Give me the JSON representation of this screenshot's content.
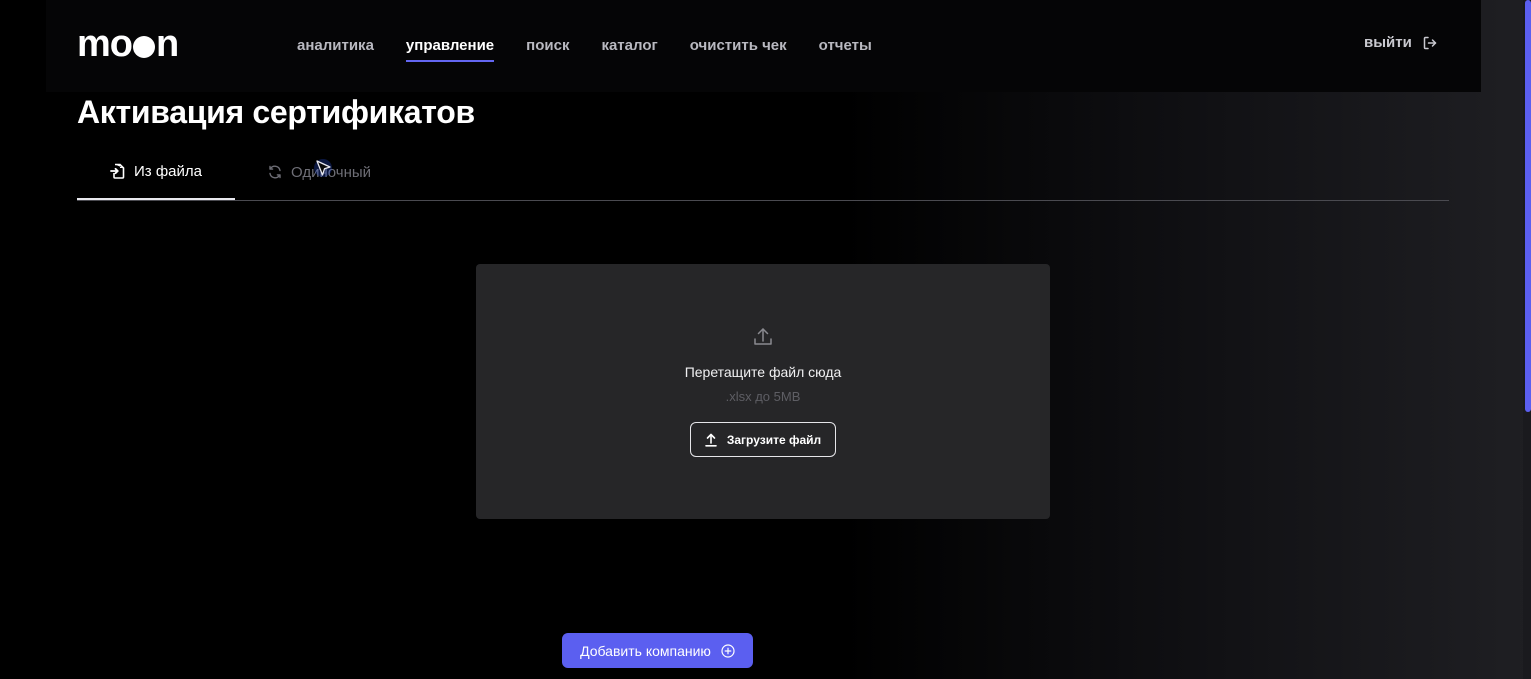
{
  "brand": {
    "logo_start": "mo",
    "logo_end": "n"
  },
  "nav": {
    "items": [
      {
        "label": "аналитика"
      },
      {
        "label": "управление"
      },
      {
        "label": "поиск"
      },
      {
        "label": "каталог"
      },
      {
        "label": "очистить чек"
      },
      {
        "label": "отчеты"
      }
    ],
    "active": "управление",
    "logout_label": "выйти"
  },
  "page": {
    "title": "Активация сертификатов"
  },
  "tabs": {
    "file_label": "Из файла",
    "single_label": "Одиночный"
  },
  "dropzone": {
    "title": "Перетащите файл сюда",
    "hint": ".xlsx до 5MB",
    "button_label": "Загрузите файл"
  },
  "actions": {
    "add_company_label": "Добавить компанию"
  },
  "colors": {
    "accent": "#5b5ff0",
    "background": "#000000",
    "panel": "#262628"
  },
  "icons": {
    "file_tab": "file-import-icon",
    "single_tab": "refresh-icon",
    "dropzone": "upload-icon",
    "logout": "logout-icon",
    "add": "plus-circle-icon"
  }
}
